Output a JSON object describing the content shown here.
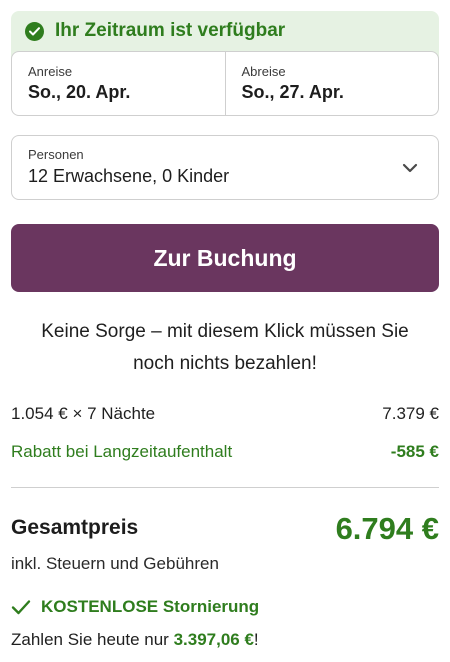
{
  "availability": {
    "message": "Ihr Zeitraum ist verfügbar",
    "icon": "check-circle-icon",
    "color": "#2f7d1e"
  },
  "dates": {
    "arrival_label": "Anreise",
    "arrival_value": "So., 20. Apr.",
    "departure_label": "Abreise",
    "departure_value": "So., 27. Apr."
  },
  "persons": {
    "label": "Personen",
    "value": "12 Erwachsene, 0 Kinder",
    "icon": "chevron-down-icon"
  },
  "booking": {
    "button_label": "Zur Buchung",
    "button_color": "#6a365f"
  },
  "reassurance": {
    "line1": "Keine Sorge – mit diesem Klick müssen Sie",
    "line2": "noch nichts bezahlen!"
  },
  "price": {
    "nights_label": "1.054 € × 7 Nächte",
    "nights_amount": "7.379 €",
    "discount_label": "Rabatt bei Langzeitaufenthalt",
    "discount_amount": "-585 €",
    "total_label": "Gesamtpreis",
    "total_amount": "6.794 €",
    "tax_note": "inkl. Steuern und Gebühren"
  },
  "cancellation": {
    "label": "KOSTENLOSE Stornierung",
    "icon": "checkmark-icon"
  },
  "pay_today": {
    "prefix": "Zahlen Sie heute nur ",
    "amount": "3.397,06 €",
    "suffix": "!"
  }
}
